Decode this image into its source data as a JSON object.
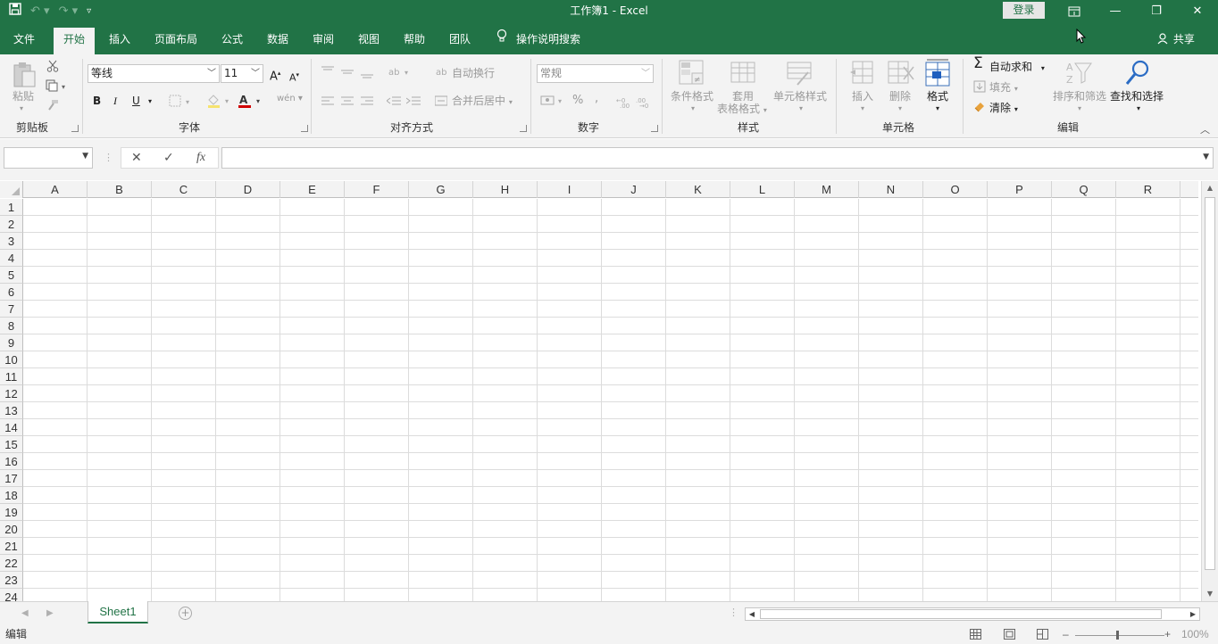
{
  "window": {
    "title": "工作簿1  -  Excel",
    "login_label": "登录",
    "qat_icons": [
      "save-icon",
      "undo-icon",
      "redo-icon",
      "customize-qat-icon"
    ],
    "window_icons": [
      "ribbon-display-options-icon",
      "minimize-icon",
      "restore-icon",
      "close-icon"
    ]
  },
  "tabs": [
    {
      "label": "文件",
      "active": false
    },
    {
      "label": "开始",
      "active": true
    },
    {
      "label": "插入",
      "active": false
    },
    {
      "label": "页面布局",
      "active": false
    },
    {
      "label": "公式",
      "active": false
    },
    {
      "label": "数据",
      "active": false
    },
    {
      "label": "审阅",
      "active": false
    },
    {
      "label": "视图",
      "active": false
    },
    {
      "label": "帮助",
      "active": false
    },
    {
      "label": "团队",
      "active": false
    }
  ],
  "tell_me": "操作说明搜索",
  "share": "共享",
  "ribbon": {
    "clipboard": {
      "group": "剪贴板",
      "paste": "粘贴"
    },
    "font": {
      "group": "字体",
      "font_name": "等线",
      "font_size": "11",
      "bold": "B",
      "italic": "I",
      "underline": "U",
      "grow": "A",
      "shrink": "A",
      "phonetic": "wén"
    },
    "alignment": {
      "group": "对齐方式",
      "wrap_text": "自动换行",
      "merge_center": "合并后居中"
    },
    "number": {
      "group": "数字",
      "format": "常规",
      "percent": "%",
      "comma": ","
    },
    "styles": {
      "group": "样式",
      "conditional": "条件格式",
      "table_format_1": "套用",
      "table_format_2": "表格格式",
      "cell_styles": "单元格样式"
    },
    "cells": {
      "group": "单元格",
      "insert": "插入",
      "delete": "删除",
      "format": "格式"
    },
    "editing": {
      "group": "编辑",
      "autosum": "自动求和",
      "fill": "填充",
      "clear": "清除",
      "sort_filter": "排序和筛选",
      "find_select": "查找和选择"
    }
  },
  "formula_bar": {
    "name_box": "",
    "formula": "",
    "cancel": "✕",
    "enter": "✓",
    "fx": "fx"
  },
  "columns": [
    "A",
    "B",
    "C",
    "D",
    "E",
    "F",
    "G",
    "H",
    "I",
    "J",
    "K",
    "L",
    "M",
    "N",
    "O",
    "P",
    "Q",
    "R"
  ],
  "rows": [
    "1",
    "2",
    "3",
    "4",
    "5",
    "6",
    "7",
    "8",
    "9",
    "10",
    "11",
    "12",
    "13",
    "14",
    "15",
    "16",
    "17",
    "18",
    "19",
    "20",
    "21",
    "22",
    "23",
    "24"
  ],
  "sheets": [
    {
      "name": "Sheet1",
      "active": true
    }
  ],
  "status": {
    "mode": "编辑",
    "zoom": "100%"
  },
  "colors": {
    "brand": "#217346",
    "ribbon_bg": "#f3f3f3"
  }
}
